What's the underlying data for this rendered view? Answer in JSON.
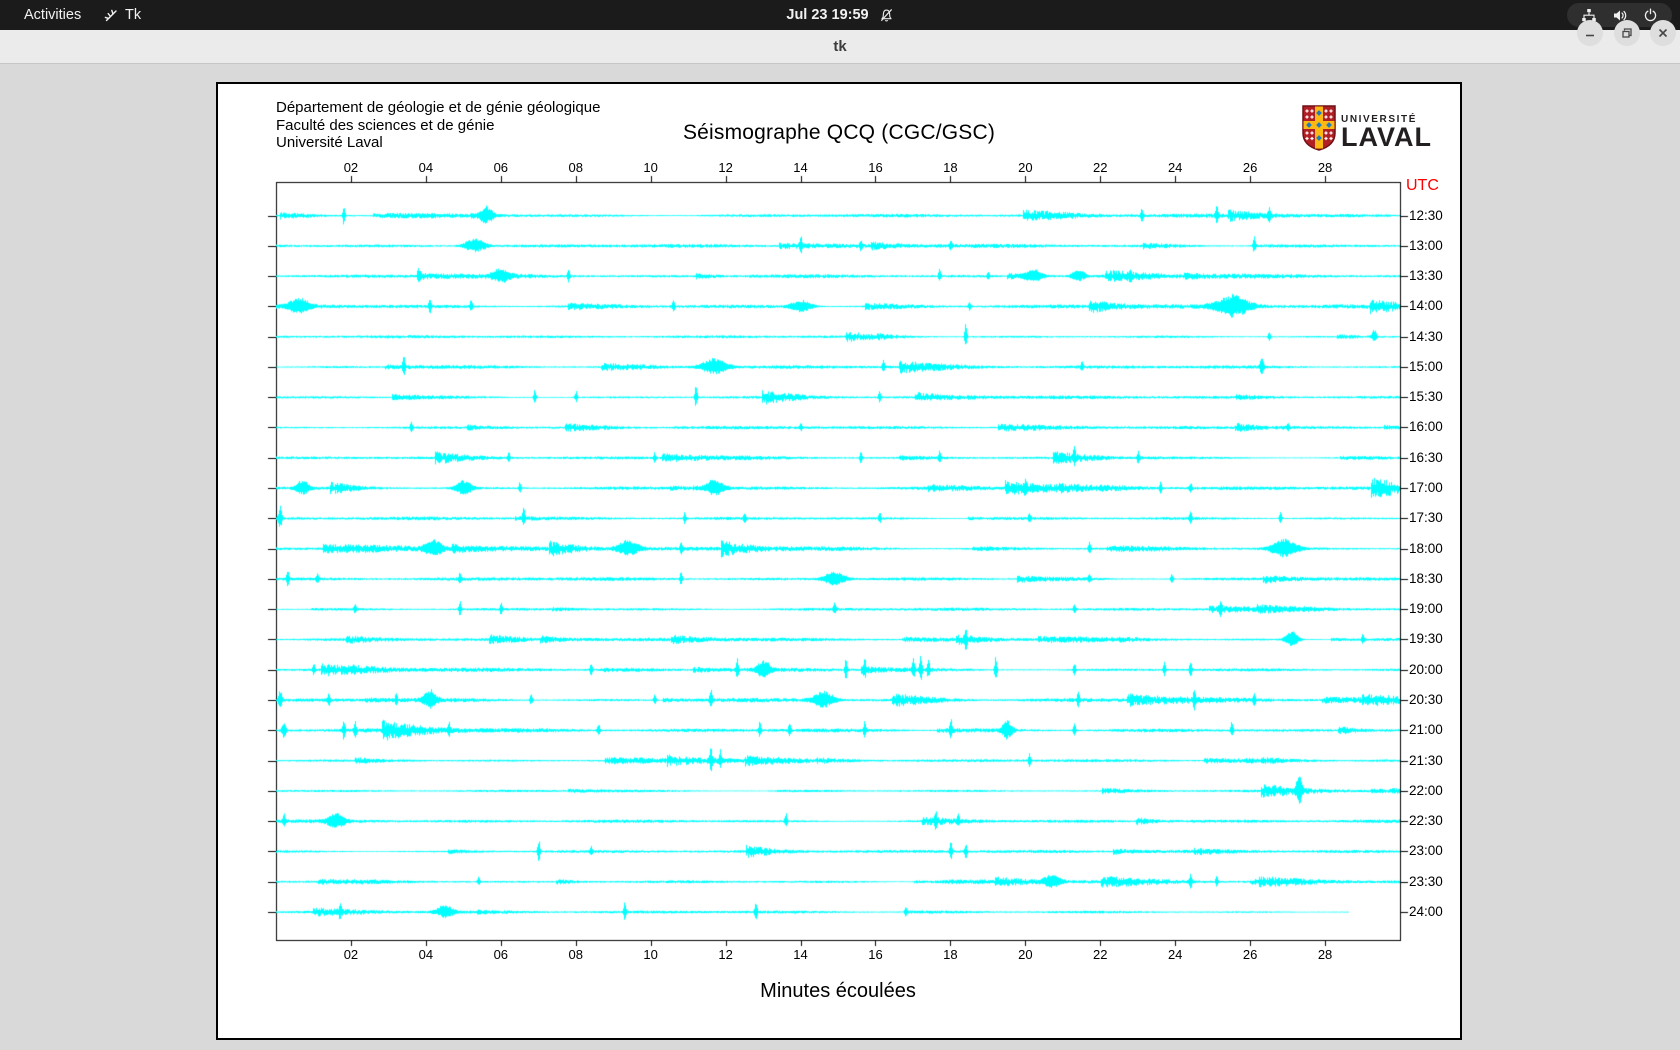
{
  "topbar": {
    "activities": "Activities",
    "app_name": "Tk",
    "clock": "Jul 23 19:59"
  },
  "titlebar": {
    "title": "tk"
  },
  "panel": {
    "header_lines": [
      "Département de géologie et de génie géologique",
      "Faculté des sciences et de génie",
      "Université Laval"
    ],
    "title": "Séismographe QCQ (CGC/GSC)",
    "logo": {
      "line1": "UNIVERSITÉ",
      "line2": "LAVAL"
    },
    "utc_label": "UTC",
    "xlabel": "Minutes écoulées"
  },
  "colors": {
    "trace": "#00ffff",
    "utc": "#ff0000",
    "panel_bg": "#ffffff",
    "app_bg": "#d9d9d9",
    "topbar_bg": "#1b1b1b",
    "titlebar_bg": "#ebebeb",
    "logo_red": "#b01f24",
    "logo_yellow": "#fdb913",
    "logo_blue": "#1f7abf"
  },
  "chart_data": {
    "type": "line",
    "variant": "helicorder-seismogram",
    "title": "Séismographe QCQ (CGC/GSC)",
    "xlabel": "Minutes écoulées",
    "right_axis_label": "UTC",
    "x_range_minutes": [
      0,
      30
    ],
    "x_tick_minutes": [
      2,
      4,
      6,
      8,
      10,
      12,
      14,
      16,
      18,
      20,
      22,
      24,
      26,
      28
    ],
    "x_ticks": [
      "02",
      "04",
      "06",
      "08",
      "10",
      "12",
      "14",
      "16",
      "18",
      "20",
      "22",
      "24",
      "26",
      "28"
    ],
    "trace_color": "#00ffff",
    "row_spacing_px": 30.28,
    "traces": [
      {
        "label": "12:30",
        "noise": 1.1,
        "end_minute": 30,
        "events": [
          [
            1.8,
            11,
            0.06
          ],
          [
            5.6,
            8,
            0.3
          ],
          [
            23.1,
            7,
            0.06
          ],
          [
            25.1,
            9,
            0.06
          ],
          [
            26.5,
            7,
            0.06
          ]
        ]
      },
      {
        "label": "13:00",
        "noise": 1.1,
        "end_minute": 30,
        "events": [
          [
            5.3,
            7,
            0.5
          ],
          [
            14,
            8,
            0.06
          ],
          [
            15.6,
            6,
            0.06
          ],
          [
            18,
            6,
            0.06
          ],
          [
            26.1,
            9,
            0.06
          ]
        ]
      },
      {
        "label": "13:30",
        "noise": 1.2,
        "end_minute": 30,
        "events": [
          [
            3.8,
            7,
            0.06
          ],
          [
            6,
            6,
            0.4
          ],
          [
            7.8,
            7,
            0.06
          ],
          [
            17.7,
            7,
            0.06
          ],
          [
            19,
            5,
            0.06
          ],
          [
            20.2,
            6,
            0.4
          ],
          [
            21.4,
            6,
            0.3
          ],
          [
            22.8,
            6,
            0.06
          ]
        ]
      },
      {
        "label": "14:00",
        "noise": 1.3,
        "end_minute": 30,
        "events": [
          [
            0.6,
            7,
            0.5
          ],
          [
            4.1,
            8,
            0.06
          ],
          [
            5.2,
            7,
            0.06
          ],
          [
            10.6,
            8,
            0.06
          ],
          [
            14,
            6,
            0.5
          ],
          [
            18.5,
            5,
            0.06
          ],
          [
            25.5,
            9,
            0.8
          ]
        ]
      },
      {
        "label": "14:30",
        "noise": 0.9,
        "end_minute": 30,
        "events": [
          [
            18.4,
            13,
            0.06
          ],
          [
            26.5,
            5,
            0.06
          ],
          [
            29.3,
            7,
            0.1
          ]
        ]
      },
      {
        "label": "15:00",
        "noise": 1.0,
        "end_minute": 30,
        "events": [
          [
            3.4,
            12,
            0.06
          ],
          [
            11.7,
            8,
            0.6
          ],
          [
            16.2,
            6,
            0.06
          ],
          [
            21.5,
            5,
            0.06
          ],
          [
            26.3,
            11,
            0.08
          ]
        ]
      },
      {
        "label": "15:30",
        "noise": 0.9,
        "end_minute": 30,
        "events": [
          [
            6.9,
            8,
            0.06
          ],
          [
            8,
            6,
            0.06
          ],
          [
            11.2,
            12,
            0.06
          ],
          [
            16.1,
            6,
            0.06
          ]
        ]
      },
      {
        "label": "16:00",
        "noise": 0.9,
        "end_minute": 30,
        "events": [
          [
            3.6,
            5,
            0.06
          ],
          [
            14,
            4,
            0.06
          ],
          [
            27,
            4,
            0.06
          ]
        ]
      },
      {
        "label": "16:30",
        "noise": 0.9,
        "end_minute": 30,
        "events": [
          [
            6.2,
            5,
            0.06
          ],
          [
            10.1,
            5,
            0.06
          ],
          [
            15.6,
            6,
            0.06
          ],
          [
            17.7,
            6,
            0.06
          ],
          [
            21.3,
            9,
            0.06
          ],
          [
            23,
            6,
            0.06
          ]
        ]
      },
      {
        "label": "17:00",
        "noise": 1.2,
        "end_minute": 30,
        "events": [
          [
            0.7,
            7,
            0.3
          ],
          [
            5,
            7,
            0.4
          ],
          [
            6.5,
            6,
            0.06
          ],
          [
            11.7,
            8,
            0.4
          ],
          [
            20,
            7,
            0.06
          ],
          [
            23.6,
            6,
            0.06
          ],
          [
            24.4,
            6,
            0.06
          ]
        ]
      },
      {
        "label": "17:30",
        "noise": 1.0,
        "end_minute": 30,
        "events": [
          [
            0.1,
            12,
            0.08
          ],
          [
            6.6,
            10,
            0.06
          ],
          [
            10.9,
            7,
            0.06
          ],
          [
            12.5,
            6,
            0.06
          ],
          [
            16.1,
            6,
            0.06
          ],
          [
            20.1,
            6,
            0.06
          ],
          [
            24.4,
            6,
            0.06
          ],
          [
            26.8,
            7,
            0.06
          ]
        ]
      },
      {
        "label": "18:00",
        "noise": 1.3,
        "end_minute": 30,
        "events": [
          [
            4.2,
            8,
            0.4
          ],
          [
            9.4,
            8,
            0.5
          ],
          [
            10.8,
            6,
            0.06
          ],
          [
            21.7,
            7,
            0.06
          ],
          [
            26.9,
            9,
            0.6
          ]
        ]
      },
      {
        "label": "18:30",
        "noise": 1.1,
        "end_minute": 30,
        "events": [
          [
            0.3,
            9,
            0.06
          ],
          [
            1.1,
            6,
            0.06
          ],
          [
            4.9,
            6,
            0.06
          ],
          [
            10.8,
            7,
            0.06
          ],
          [
            14.9,
            7,
            0.5
          ],
          [
            21.7,
            5,
            0.06
          ],
          [
            23.9,
            5,
            0.06
          ]
        ]
      },
      {
        "label": "19:00",
        "noise": 1.0,
        "end_minute": 30,
        "events": [
          [
            2.1,
            5,
            0.06
          ],
          [
            4.9,
            8,
            0.06
          ],
          [
            6,
            6,
            0.06
          ],
          [
            14.9,
            7,
            0.06
          ],
          [
            21.3,
            5,
            0.06
          ],
          [
            25.2,
            6,
            0.06
          ]
        ]
      },
      {
        "label": "19:30",
        "noise": 0.9,
        "end_minute": 30,
        "events": [
          [
            18.4,
            10,
            0.06
          ],
          [
            27.1,
            8,
            0.3
          ],
          [
            29,
            6,
            0.06
          ]
        ]
      },
      {
        "label": "20:00",
        "noise": 1.1,
        "end_minute": 30,
        "events": [
          [
            1,
            6,
            0.06
          ],
          [
            8.4,
            6,
            0.06
          ],
          [
            12.3,
            10,
            0.06
          ],
          [
            13,
            9,
            0.3
          ],
          [
            15.2,
            11,
            0.06
          ],
          [
            15.7,
            9,
            0.06
          ],
          [
            17.0,
            13,
            0.06
          ],
          [
            17.2,
            15,
            0.06
          ],
          [
            17.4,
            11,
            0.06
          ],
          [
            19.2,
            14,
            0.06
          ],
          [
            21.3,
            7,
            0.06
          ],
          [
            23.7,
            8,
            0.06
          ],
          [
            24.4,
            9,
            0.06
          ]
        ]
      },
      {
        "label": "20:30",
        "noise": 1.3,
        "end_minute": 30,
        "events": [
          [
            0.1,
            10,
            0.08
          ],
          [
            1.4,
            7,
            0.06
          ],
          [
            3.2,
            7,
            0.06
          ],
          [
            4.1,
            9,
            0.3
          ],
          [
            6.8,
            6,
            0.06
          ],
          [
            10.1,
            6,
            0.06
          ],
          [
            11.6,
            12,
            0.06
          ],
          [
            14.6,
            8,
            0.5
          ],
          [
            21.4,
            8,
            0.06
          ],
          [
            24.5,
            10,
            0.06
          ],
          [
            26.1,
            6,
            0.06
          ]
        ]
      },
      {
        "label": "21:00",
        "noise": 1.3,
        "end_minute": 30,
        "events": [
          [
            0.2,
            8,
            0.1
          ],
          [
            1.8,
            12,
            0.06
          ],
          [
            2.1,
            10,
            0.06
          ],
          [
            4.6,
            9,
            0.06
          ],
          [
            8.6,
            7,
            0.06
          ],
          [
            12.9,
            8,
            0.06
          ],
          [
            13.7,
            8,
            0.06
          ],
          [
            15.7,
            9,
            0.06
          ],
          [
            18,
            11,
            0.06
          ],
          [
            19.5,
            9,
            0.25
          ],
          [
            21.3,
            7,
            0.06
          ],
          [
            25.5,
            9,
            0.06
          ]
        ]
      },
      {
        "label": "21:30",
        "noise": 0.9,
        "end_minute": 30,
        "events": [
          [
            11.6,
            13,
            0.06
          ],
          [
            11.85,
            9,
            0.06
          ],
          [
            20.1,
            7,
            0.06
          ]
        ]
      },
      {
        "label": "22:00",
        "noise": 0.8,
        "end_minute": 30,
        "events": [
          [
            27.3,
            12,
            0.15
          ]
        ]
      },
      {
        "label": "22:30",
        "noise": 1.1,
        "end_minute": 30,
        "events": [
          [
            0.2,
            7,
            0.06
          ],
          [
            1.6,
            7,
            0.4
          ],
          [
            13.6,
            8,
            0.06
          ],
          [
            17.6,
            12,
            0.06
          ],
          [
            18.2,
            6,
            0.06
          ]
        ]
      },
      {
        "label": "23:00",
        "noise": 0.9,
        "end_minute": 30,
        "events": [
          [
            7.0,
            12,
            0.06
          ],
          [
            8.4,
            5,
            0.06
          ],
          [
            18,
            10,
            0.06
          ],
          [
            18.4,
            8,
            0.06
          ]
        ]
      },
      {
        "label": "23:30",
        "noise": 1.0,
        "end_minute": 30,
        "events": [
          [
            5.4,
            5,
            0.06
          ],
          [
            20.7,
            6,
            0.4
          ],
          [
            24.4,
            9,
            0.06
          ],
          [
            25.1,
            5,
            0.06
          ]
        ]
      },
      {
        "label": "24:00",
        "noise": 0.9,
        "end_minute": 28.6,
        "events": [
          [
            1.7,
            7,
            0.06
          ],
          [
            4.5,
            6,
            0.4
          ],
          [
            9.3,
            10,
            0.06
          ],
          [
            12.8,
            11,
            0.06
          ],
          [
            16.8,
            7,
            0.06
          ]
        ]
      }
    ]
  }
}
